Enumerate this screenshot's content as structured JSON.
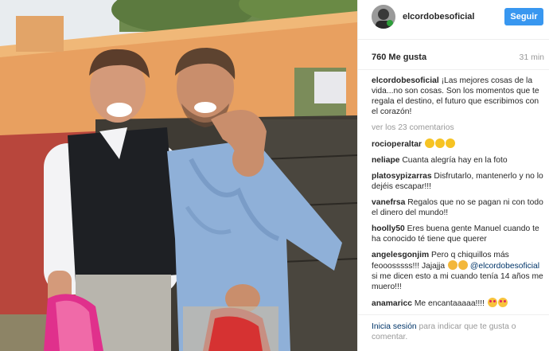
{
  "post": {
    "username": "elcordobesoficial",
    "follow_label": "Seguir",
    "likes": "760 Me gusta",
    "time": "31 min"
  },
  "caption": {
    "username": "elcordobesoficial",
    "text": "¡Las mejores cosas de la vida...no son cosas. Son los momentos que te regala el destino, el futuro que escribimos con el corazón!"
  },
  "view_all": "ver los 23 comentarios",
  "comments": [
    {
      "user": "rocioperaltar",
      "text": ""
    },
    {
      "user": "neliape",
      "text": "Cuanta alegría hay en la foto"
    },
    {
      "user": "platosypizarras",
      "text": "Disfrutarlo, mantenerlo y no lo dejéis escapar!!!"
    },
    {
      "user": "vanefrsa",
      "text": "Regalos que no se pagan ni con todo el dinero del mundo!!"
    },
    {
      "user": "hoolly50",
      "text": "Eres buena gente Manuel cuando te ha conocido té tiene que querer"
    },
    {
      "user": "angelesgonjim",
      "text": "Pero q chiquillos más feooosssss!!! Jajajja",
      "mention": "@elcordobesoficial",
      "text2": "si me dicen esto a mi cuando tenía 14 años me muero!!!"
    },
    {
      "user": "anamaricc",
      "text": "Me encantaaaaa!!!!"
    }
  ],
  "footer": {
    "login": "Inicia sesión",
    "rest": "para indicar que te gusta o comentar."
  },
  "icons": {
    "clap": "clapping-hands-icon",
    "smile": "smiling-face-icon",
    "heart_eyes": "heart-eyes-icon"
  }
}
